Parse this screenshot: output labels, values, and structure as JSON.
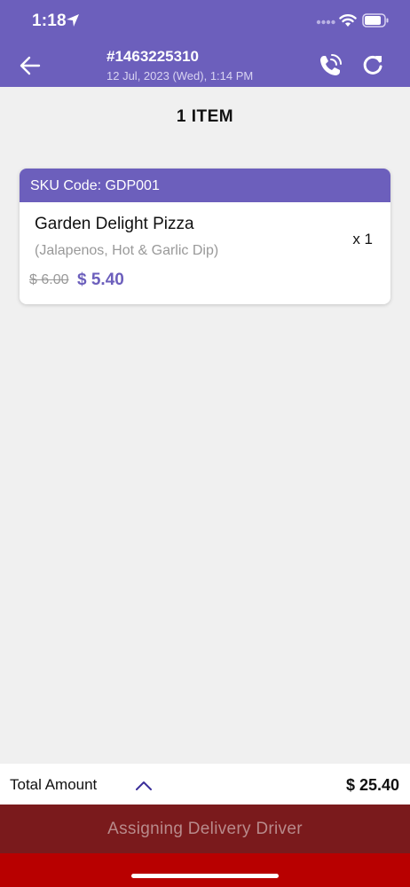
{
  "status_bar": {
    "time": "1:18"
  },
  "header": {
    "order_number": "#1463225310",
    "order_datetime": "12 Jul, 2023 (Wed),  1:14 PM",
    "icons": {
      "back": "arrow-left-icon",
      "call": "phone-call-icon",
      "refresh": "refresh-icon"
    }
  },
  "items_heading": "1 ITEM",
  "items": [
    {
      "sku_label": "SKU Code: GDP001",
      "name": "Garden Delight Pizza",
      "options": "(Jalapenos, Hot & Garlic Dip)",
      "quantity": "x 1",
      "original_price": "$ 6.00",
      "price": "$ 5.40"
    }
  ],
  "total": {
    "label": "Total Amount",
    "value": "$ 25.40",
    "toggle_icon": "chevron-up-icon"
  },
  "status_button": "Assigning Delivery Driver",
  "colors": {
    "brand": "#6c5fbc",
    "status_bar_bg": "#7a1a1c",
    "bottom_strip": "#b80000"
  }
}
